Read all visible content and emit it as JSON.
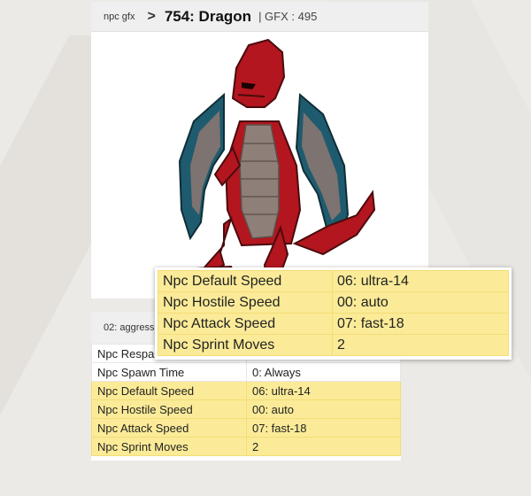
{
  "header": {
    "breadcrumb": "npc gfx",
    "separator": ">",
    "title": "754: Dragon",
    "gfx_label": "| GFX : 495"
  },
  "sprite": {
    "name": "Dragon",
    "body_color": "#b3161e",
    "wing_color": "#1f5b6e",
    "belly_color": "#8e7f78"
  },
  "panel2": {
    "header": "02: aggress",
    "rows": [
      {
        "label": "Npc Respa",
        "value": ""
      },
      {
        "label": "Npc Spawn Time",
        "value": "0: Always"
      },
      {
        "label": "Npc Default Speed",
        "value": "06: ultra-14"
      },
      {
        "label": "Npc Hostile Speed",
        "value": "00: auto"
      },
      {
        "label": "Npc Attack Speed",
        "value": "07: fast-18"
      },
      {
        "label": "Npc Sprint Moves",
        "value": "2"
      }
    ]
  },
  "callout": {
    "rows": [
      {
        "label": "Npc Default Speed",
        "value": "06: ultra-14"
      },
      {
        "label": "Npc Hostile Speed",
        "value": "00: auto"
      },
      {
        "label": "Npc Attack Speed",
        "value": "07: fast-18"
      },
      {
        "label": "Npc Sprint Moves",
        "value": "2"
      }
    ]
  },
  "colors": {
    "highlight": "#fbeb98",
    "header_bg": "#efefef",
    "page_bg": "#eceae6"
  }
}
